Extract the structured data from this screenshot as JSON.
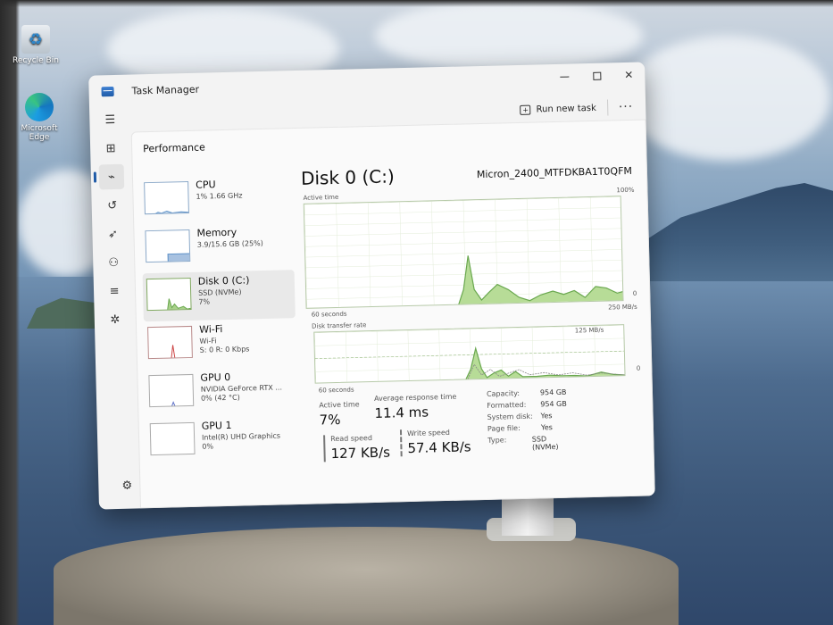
{
  "desktop": {
    "icons": [
      {
        "label": "Recycle Bin",
        "icon": "recycle-bin-icon"
      },
      {
        "label": "Microsoft Edge",
        "icon": "edge-icon"
      }
    ]
  },
  "window": {
    "title": "Task Manager",
    "controls": {
      "minimize": "minimize-icon",
      "maximize": "maximize-icon",
      "close": "✕"
    },
    "command_bar": {
      "run_new_task": "Run new task",
      "more": "···"
    },
    "rail_icons": [
      "hamburger-icon",
      "processes-icon",
      "performance-icon",
      "app-history-icon",
      "startup-apps-icon",
      "users-icon",
      "details-icon",
      "services-icon",
      "settings-icon"
    ],
    "page_title": "Performance",
    "sidebar": [
      {
        "name": "CPU",
        "sub": "1% 1.66 GHz",
        "val": ""
      },
      {
        "name": "Memory",
        "sub": "3.9/15.6 GB (25%)",
        "val": ""
      },
      {
        "name": "Disk 0 (C:)",
        "sub": "SSD (NVMe)",
        "val": "7%"
      },
      {
        "name": "Wi-Fi",
        "sub": "Wi-Fi",
        "val": "S: 0 R: 0 Kbps"
      },
      {
        "name": "GPU 0",
        "sub": "NVIDIA GeForce RTX ...",
        "val": "0% (42 °C)"
      },
      {
        "name": "GPU 1",
        "sub": "Intel(R) UHD Graphics",
        "val": "0%"
      }
    ],
    "detail": {
      "title": "Disk 0 (C:)",
      "model": "Micron_2400_MTFDKBA1T0QFM",
      "active_chart": {
        "label": "Active time",
        "max": "100%",
        "min": "0",
        "span": "60 seconds"
      },
      "transfer_chart": {
        "label": "Disk transfer rate",
        "max": "250 MB/s",
        "mid": "125 MB/s",
        "min": "0",
        "span": "60 seconds"
      },
      "stats": {
        "active_time_label": "Active time",
        "active_time": "7%",
        "avg_resp_label": "Average response time",
        "avg_resp": "11.4 ms",
        "read_label": "Read speed",
        "read": "127 KB/s",
        "write_label": "Write speed",
        "write": "57.4 KB/s"
      },
      "properties": [
        {
          "k": "Capacity:",
          "v": "954 GB"
        },
        {
          "k": "Formatted:",
          "v": "954 GB"
        },
        {
          "k": "System disk:",
          "v": "Yes"
        },
        {
          "k": "Page file:",
          "v": "Yes"
        },
        {
          "k": "Type:",
          "v": "SSD (NVMe)"
        }
      ]
    }
  }
}
